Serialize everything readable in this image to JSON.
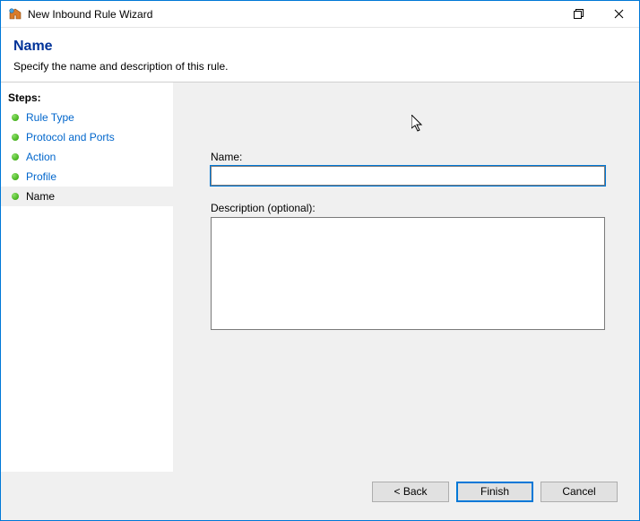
{
  "titlebar": {
    "title": "New Inbound Rule Wizard"
  },
  "header": {
    "heading": "Name",
    "subtitle": "Specify the name and description of this rule."
  },
  "sidebar": {
    "steps_header": "Steps:",
    "steps": [
      {
        "label": "Rule Type",
        "link": true
      },
      {
        "label": "Protocol and Ports",
        "link": true
      },
      {
        "label": "Action",
        "link": true
      },
      {
        "label": "Profile",
        "link": true
      },
      {
        "label": "Name",
        "link": false,
        "current": true
      }
    ]
  },
  "form": {
    "name_label": "Name:",
    "name_value": "",
    "desc_label": "Description (optional):",
    "desc_value": ""
  },
  "buttons": {
    "back": "< Back",
    "finish": "Finish",
    "cancel": "Cancel"
  }
}
